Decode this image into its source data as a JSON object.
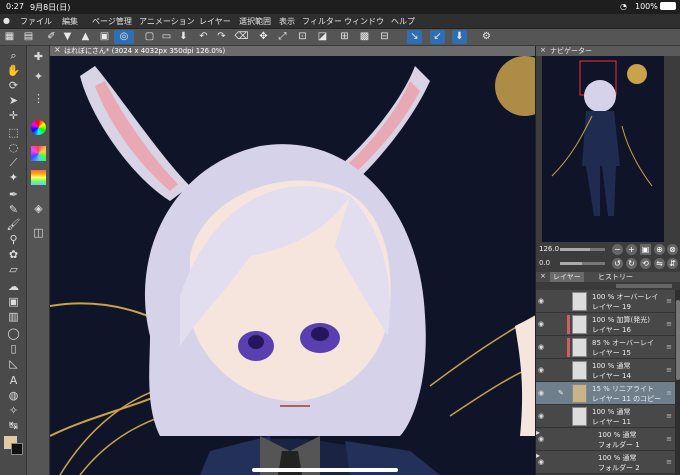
{
  "status": {
    "time": "0:27",
    "date": "9月8日(日)",
    "battery": "100%"
  },
  "menu": [
    "ファイル",
    "編集",
    "ページ管理",
    "アニメーション",
    "レイヤー",
    "選択範囲",
    "表示",
    "フィルター",
    "ウィンドウ",
    "ヘルプ"
  ],
  "canvas": {
    "tab_title": "はれぼにさん* (3024 x 4032px 350dpi 126.0%)"
  },
  "navigator": {
    "tab_label": "ナビゲーター",
    "zoom": "126.0",
    "rotation": "0.0"
  },
  "layer_panel": {
    "tabs": [
      "レイヤー",
      "ヒストリー"
    ],
    "layers": [
      {
        "blend": "100 % オーバーレイ",
        "name": "レイヤー 19",
        "clip": false,
        "selected": false,
        "thumb": "#e8e8e8"
      },
      {
        "blend": "100 % 加算(発光)",
        "name": "レイヤー 16",
        "clip": true,
        "selected": false,
        "thumb": "#e8e8e8"
      },
      {
        "blend": "85 % オーバーレイ",
        "name": "レイヤー 15",
        "clip": true,
        "selected": false,
        "thumb": "#e8e8e8"
      },
      {
        "blend": "100 % 通常",
        "name": "レイヤー 14",
        "clip": false,
        "selected": false,
        "thumb": "#e8e8e8"
      },
      {
        "blend": "15 % リニアライト",
        "name": "レイヤー 11 のコピー",
        "clip": false,
        "selected": true,
        "thumb": "#c9b48a"
      },
      {
        "blend": "100 % 通常",
        "name": "レイヤー 11",
        "clip": false,
        "selected": false,
        "thumb": "#e8e8e8"
      }
    ],
    "folders": [
      {
        "label": "100 % 通常\nフォルダー 1",
        "name": "フォルダー 1"
      },
      {
        "label": "100 % 通常",
        "name": "フォルダー 2"
      }
    ]
  },
  "colors": {
    "canvas_bg": "#0f1428",
    "accent": "#2f6fb1",
    "selected_layer": "#6f7f8c",
    "clip_mark": "#d06060"
  },
  "icons": {
    "commandbar": [
      "undo-icon",
      "redo-icon",
      "save-icon",
      "new-icon",
      "open-icon",
      "settings-icon"
    ],
    "tools": [
      "magnifier-icon",
      "hand-icon",
      "rotate-icon",
      "operation-icon",
      "move-icon",
      "select-icon",
      "lasso-icon",
      "wand-icon",
      "eyedropper-icon",
      "pen-icon",
      "pencil-icon",
      "brush-icon",
      "airbrush-icon",
      "decoration-icon",
      "eraser-icon",
      "blend-icon",
      "fill-icon",
      "gradient-icon",
      "figure-icon",
      "frame-icon",
      "ruler-icon",
      "text-icon",
      "balloon-icon",
      "line-correct-icon"
    ]
  }
}
